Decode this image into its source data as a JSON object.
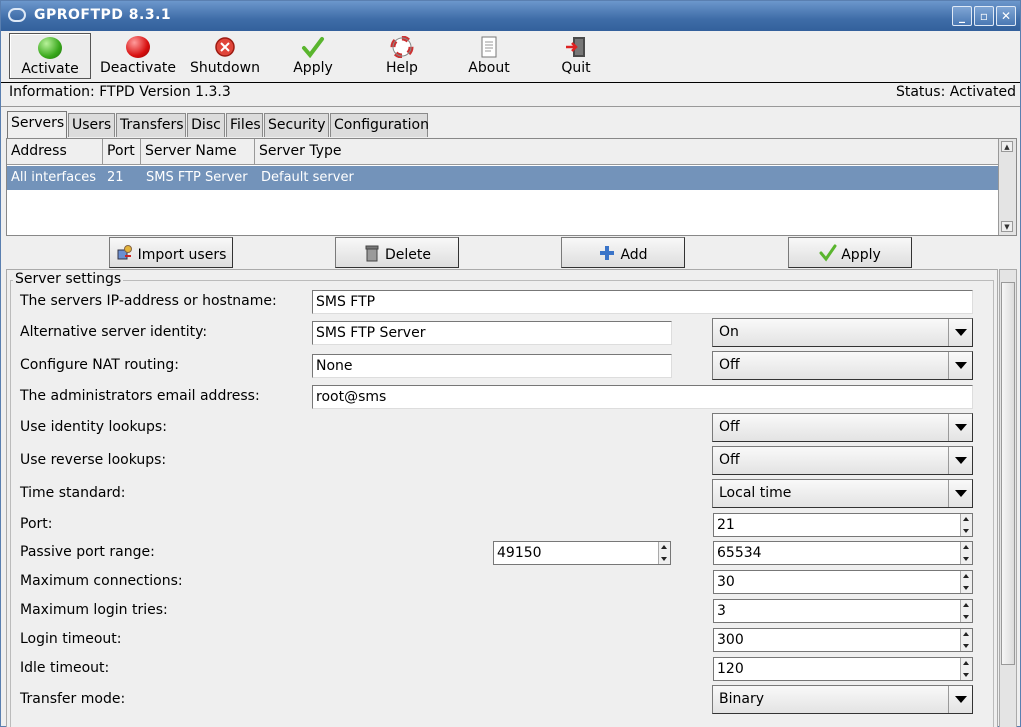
{
  "window": {
    "title": "GPROFTPD 8.3.1"
  },
  "toolbar": [
    {
      "label": "Activate",
      "icon": "green-light-icon"
    },
    {
      "label": "Deactivate",
      "icon": "red-light-icon"
    },
    {
      "label": "Shutdown",
      "icon": "shutdown-icon"
    },
    {
      "label": "Apply",
      "icon": "checkmark-icon"
    },
    {
      "label": "Help",
      "icon": "lifebuoy-icon"
    },
    {
      "label": "About",
      "icon": "document-icon"
    },
    {
      "label": "Quit",
      "icon": "exit-door-icon"
    }
  ],
  "info": {
    "text": "Information: FTPD Version 1.3.3",
    "status": "Status: Activated"
  },
  "tabs": [
    "Servers",
    "Users",
    "Transfers",
    "Disc",
    "Files",
    "Security",
    "Configuration"
  ],
  "servers": {
    "columns": [
      "Address",
      "Port",
      "Server Name",
      "Server Type"
    ],
    "rows": [
      [
        "All interfaces",
        "21",
        "SMS FTP Server",
        "Default server"
      ]
    ]
  },
  "buttons": {
    "import": "Import users",
    "delete": "Delete",
    "add": "Add",
    "apply": "Apply"
  },
  "settings": {
    "legend": "Server settings",
    "ip_label": "The servers IP-address or hostname:",
    "ip_value": "SMS FTP",
    "alt_label": "Alternative server identity:",
    "alt_value": "SMS FTP Server",
    "alt_toggle": "On",
    "nat_label": "Configure NAT routing:",
    "nat_value": "None",
    "nat_toggle": "Off",
    "email_label": "The administrators email address:",
    "email_value": "root@sms",
    "ident_label": "Use identity lookups:",
    "ident_value": "Off",
    "reverse_label": "Use reverse lookups:",
    "reverse_value": "Off",
    "time_label": "Time standard:",
    "time_value": "Local time",
    "port_label": "Port:",
    "port_value": "21",
    "passive_label": "Passive port range:",
    "passive_from": "49150",
    "passive_to": "65534",
    "maxconn_label": "Maximum connections:",
    "maxconn_value": "30",
    "maxlogin_label": "Maximum login tries:",
    "maxlogin_value": "3",
    "logintimeout_label": "Login timeout:",
    "logintimeout_value": "300",
    "idletimeout_label": "Idle timeout:",
    "idletimeout_value": "120",
    "transfer_label": "Transfer mode:",
    "transfer_value": "Binary"
  }
}
